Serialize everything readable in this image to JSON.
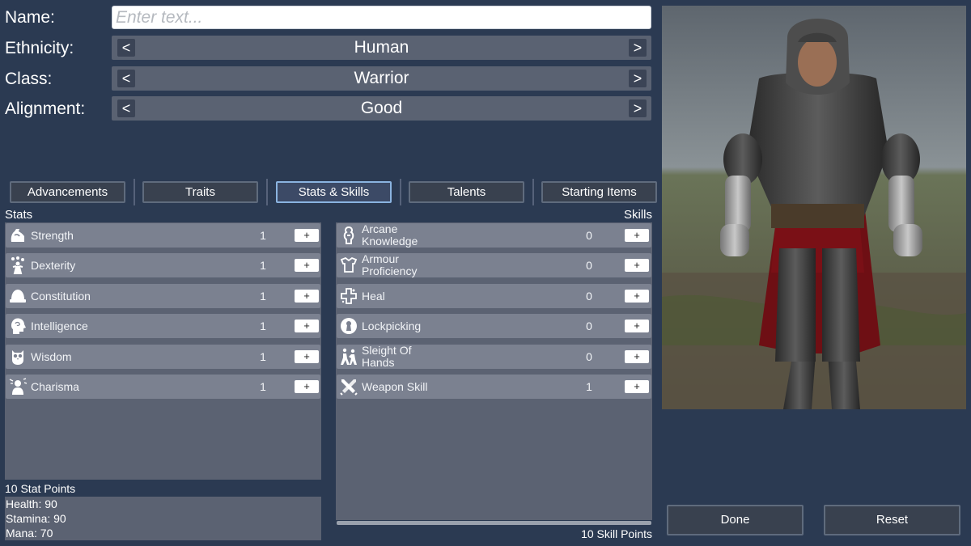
{
  "form": {
    "name_label": "Name:",
    "name_placeholder": "Enter text...",
    "ethnicity_label": "Ethnicity:",
    "ethnicity_value": "Human",
    "class_label": "Class:",
    "class_value": "Warrior",
    "alignment_label": "Alignment:",
    "alignment_value": "Good",
    "prev_symbol": "<",
    "next_symbol": ">"
  },
  "tabs": [
    {
      "label": "Advancements",
      "active": false
    },
    {
      "label": "Traits",
      "active": false
    },
    {
      "label": "Stats & Skills",
      "active": true
    },
    {
      "label": "Talents",
      "active": false
    },
    {
      "label": "Starting Items",
      "active": false
    }
  ],
  "stats": {
    "header": "Stats",
    "items": [
      {
        "label": "Strength",
        "value": "1",
        "icon": "flexed-arm-icon"
      },
      {
        "label": "Dexterity",
        "value": "1",
        "icon": "juggling-icon"
      },
      {
        "label": "Constitution",
        "value": "1",
        "icon": "helmet-icon"
      },
      {
        "label": "Intelligence",
        "value": "1",
        "icon": "brain-head-icon"
      },
      {
        "label": "Wisdom",
        "value": "1",
        "icon": "owl-icon"
      },
      {
        "label": "Charisma",
        "value": "1",
        "icon": "person-speaking-icon"
      }
    ],
    "plus_label": "+",
    "points": "10 Stat Points",
    "health": "Health: 90",
    "stamina": "Stamina: 90",
    "mana": "Mana: 70"
  },
  "skills": {
    "header": "Skills",
    "items": [
      {
        "label": "Arcane Knowledge",
        "value": "0",
        "icon": "arcane-icon"
      },
      {
        "label": "Armour Proficiency",
        "value": "0",
        "icon": "breastplate-icon"
      },
      {
        "label": "Heal",
        "value": "0",
        "icon": "health-cross-icon"
      },
      {
        "label": "Lockpicking",
        "value": "0",
        "icon": "keyhole-icon"
      },
      {
        "label": "Sleight Of Hands",
        "value": "0",
        "icon": "pickpocket-icon"
      },
      {
        "label": "Weapon Skill",
        "value": "1",
        "icon": "crossed-swords-icon"
      }
    ],
    "plus_label": "+",
    "points": "10 Skill Points"
  },
  "actions": {
    "done": "Done",
    "reset": "Reset"
  },
  "colors": {
    "background": "#2b3a52",
    "row": "#7b8190",
    "panel": "#5b6272",
    "active_tab_border": "#8ab3e0"
  }
}
